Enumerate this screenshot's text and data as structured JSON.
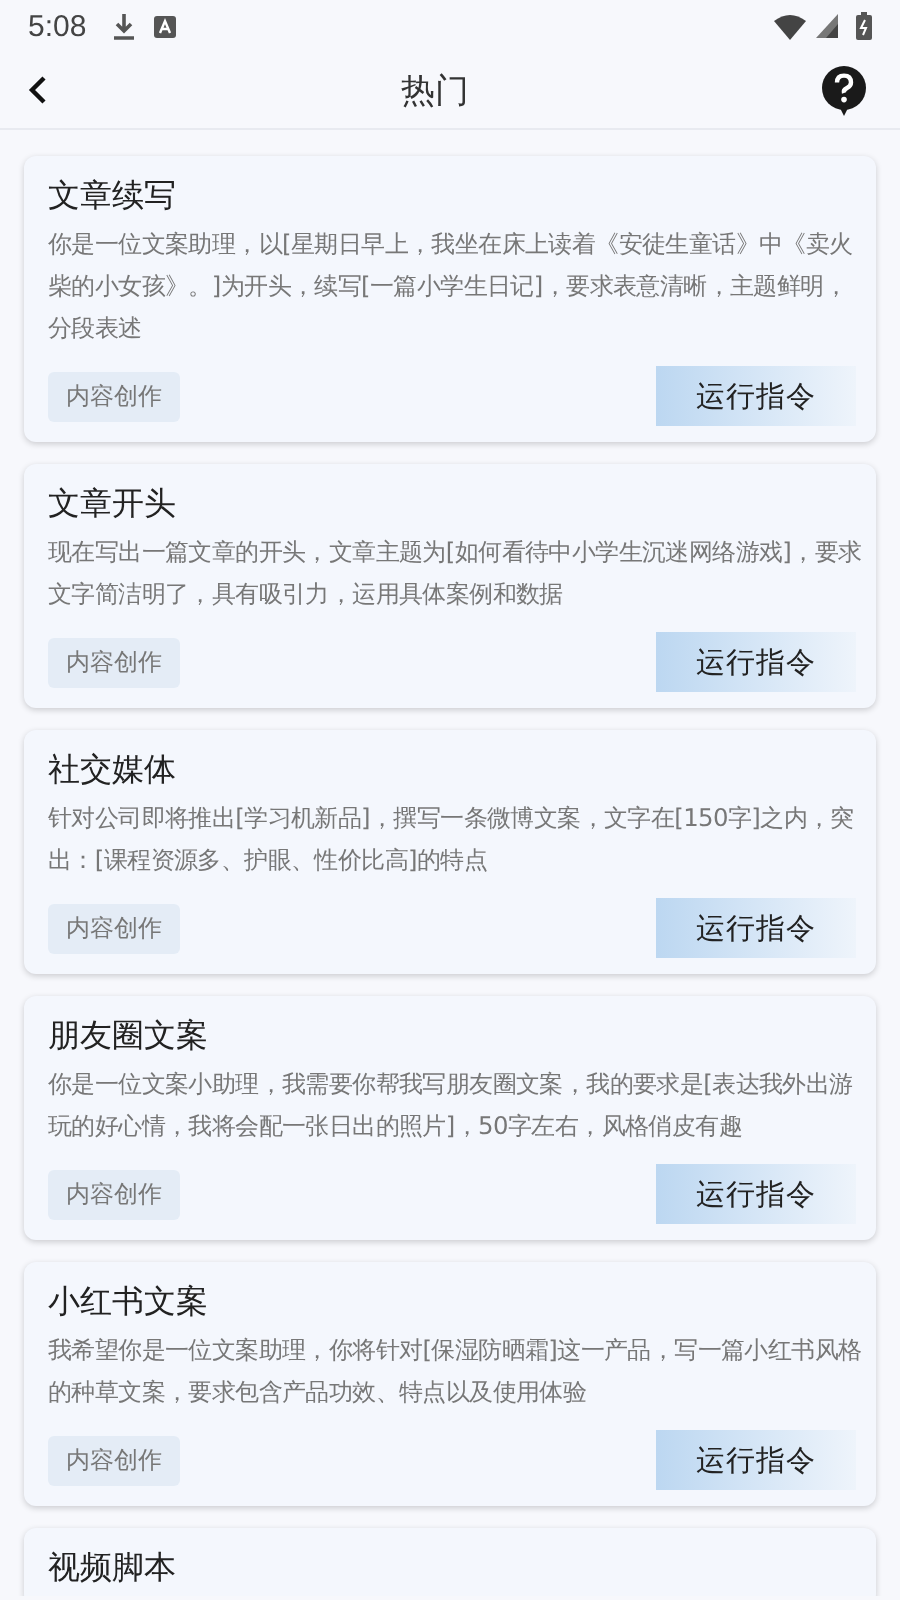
{
  "status_bar": {
    "time": "5:08"
  },
  "header": {
    "title": "热门"
  },
  "cards": [
    {
      "title": "文章续写",
      "description": "你是一位文案助理，以[星期日早上，我坐在床上读着《安徒生童话》中《卖火柴的小女孩》。]为开头，续写[一篇小学生日记]，要求表意清晰，主题鲜明，分段表述",
      "tag": "内容创作",
      "button": "运行指令"
    },
    {
      "title": "文章开头",
      "description": "现在写出一篇文章的开头，文章主题为[如何看待中小学生沉迷网络游戏]，要求文字简洁明了，具有吸引力，运用具体案例和数据",
      "tag": "内容创作",
      "button": "运行指令"
    },
    {
      "title": "社交媒体",
      "description": "针对公司即将推出[学习机新品]，撰写一条微博文案，文字在[150字]之内，突出：[课程资源多、护眼、性价比高]的特点",
      "tag": "内容创作",
      "button": "运行指令"
    },
    {
      "title": "朋友圈文案",
      "description": "你是一位文案小助理，我需要你帮我写朋友圈文案，我的要求是[表达我外出游玩的好心情，我将会配一张日出的照片]，50字左右，风格俏皮有趣",
      "tag": "内容创作",
      "button": "运行指令"
    },
    {
      "title": "小红书文案",
      "description": "我希望你是一位文案助理，你将针对[保湿防晒霜]这一产品，写一篇小红书风格的种草文案，要求包含产品功效、特点以及使用体验",
      "tag": "内容创作",
      "button": "运行指令"
    },
    {
      "title": "视频脚本"
    }
  ]
}
